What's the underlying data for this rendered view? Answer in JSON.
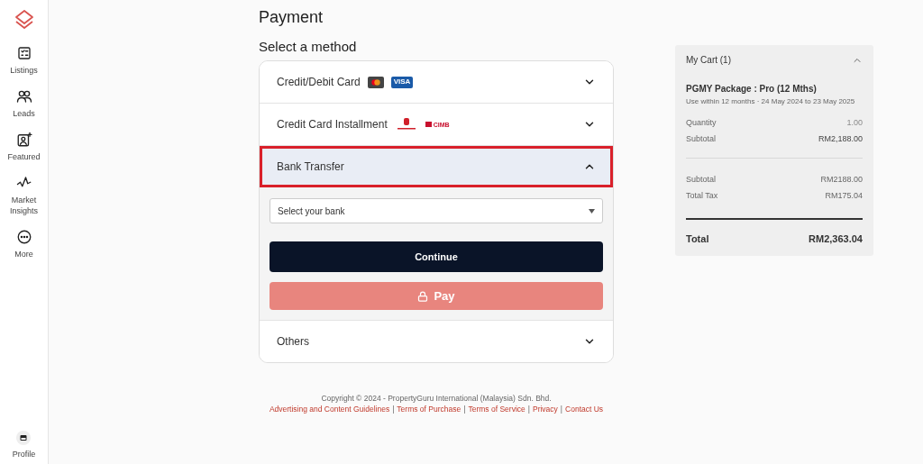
{
  "sidebar": {
    "items": [
      {
        "kind": "listings",
        "label": "Listings"
      },
      {
        "kind": "leads",
        "label": "Leads"
      },
      {
        "kind": "featured",
        "label": "Featured"
      },
      {
        "kind": "insights",
        "label": "Market\nInsights"
      },
      {
        "kind": "more",
        "label": "More"
      }
    ],
    "profile": {
      "label": "Profile"
    }
  },
  "page_title": "Payment",
  "section_title": "Select a method",
  "methods": [
    {
      "label": "Credit/Debit Card",
      "expanded": false,
      "highlighted": false,
      "logos": [
        {
          "kind": "mastercard"
        },
        {
          "kind": "visa",
          "text": "VISA"
        }
      ]
    },
    {
      "label": "Credit Card Installment",
      "expanded": false,
      "highlighted": false,
      "logos": [
        {
          "kind": "publicbank"
        },
        {
          "kind": "cimb",
          "text": "CIMB"
        }
      ]
    },
    {
      "label": "Bank Transfer",
      "expanded": true,
      "highlighted": true,
      "bank_select": {
        "placeholder": "Select your bank"
      },
      "continue_button": "Continue",
      "pay_button": {
        "label": "Pay",
        "disabled": true
      }
    },
    {
      "label": "Others",
      "expanded": false,
      "highlighted": false
    }
  ],
  "cart": {
    "title": "My Cart (1)",
    "expanded": true,
    "item": {
      "name": "PGMY Package : Pro (12 Mths)",
      "validity": "Use within 12 months · 24 May 2024 to 23 May 2025"
    },
    "item_rows": [
      {
        "label": "Quantity",
        "value": "1.00",
        "muted": true
      },
      {
        "label": "Subtotal",
        "value": "RM2,188.00",
        "muted": false
      }
    ],
    "summary_rows": [
      {
        "label": "Subtotal",
        "value": "RM2188.00"
      },
      {
        "label": "Total Tax",
        "value": "RM175.04"
      }
    ],
    "total": {
      "label": "Total",
      "value": "RM2,363.04"
    }
  },
  "footer": {
    "copyright": "Copyright © 2024 - PropertyGuru International (Malaysia) Sdn. Bhd.",
    "links": [
      "Advertising and Content Guidelines",
      "Terms of Purchase",
      "Terms of Service",
      "Privacy",
      "Contact Us"
    ],
    "separator": "|"
  }
}
